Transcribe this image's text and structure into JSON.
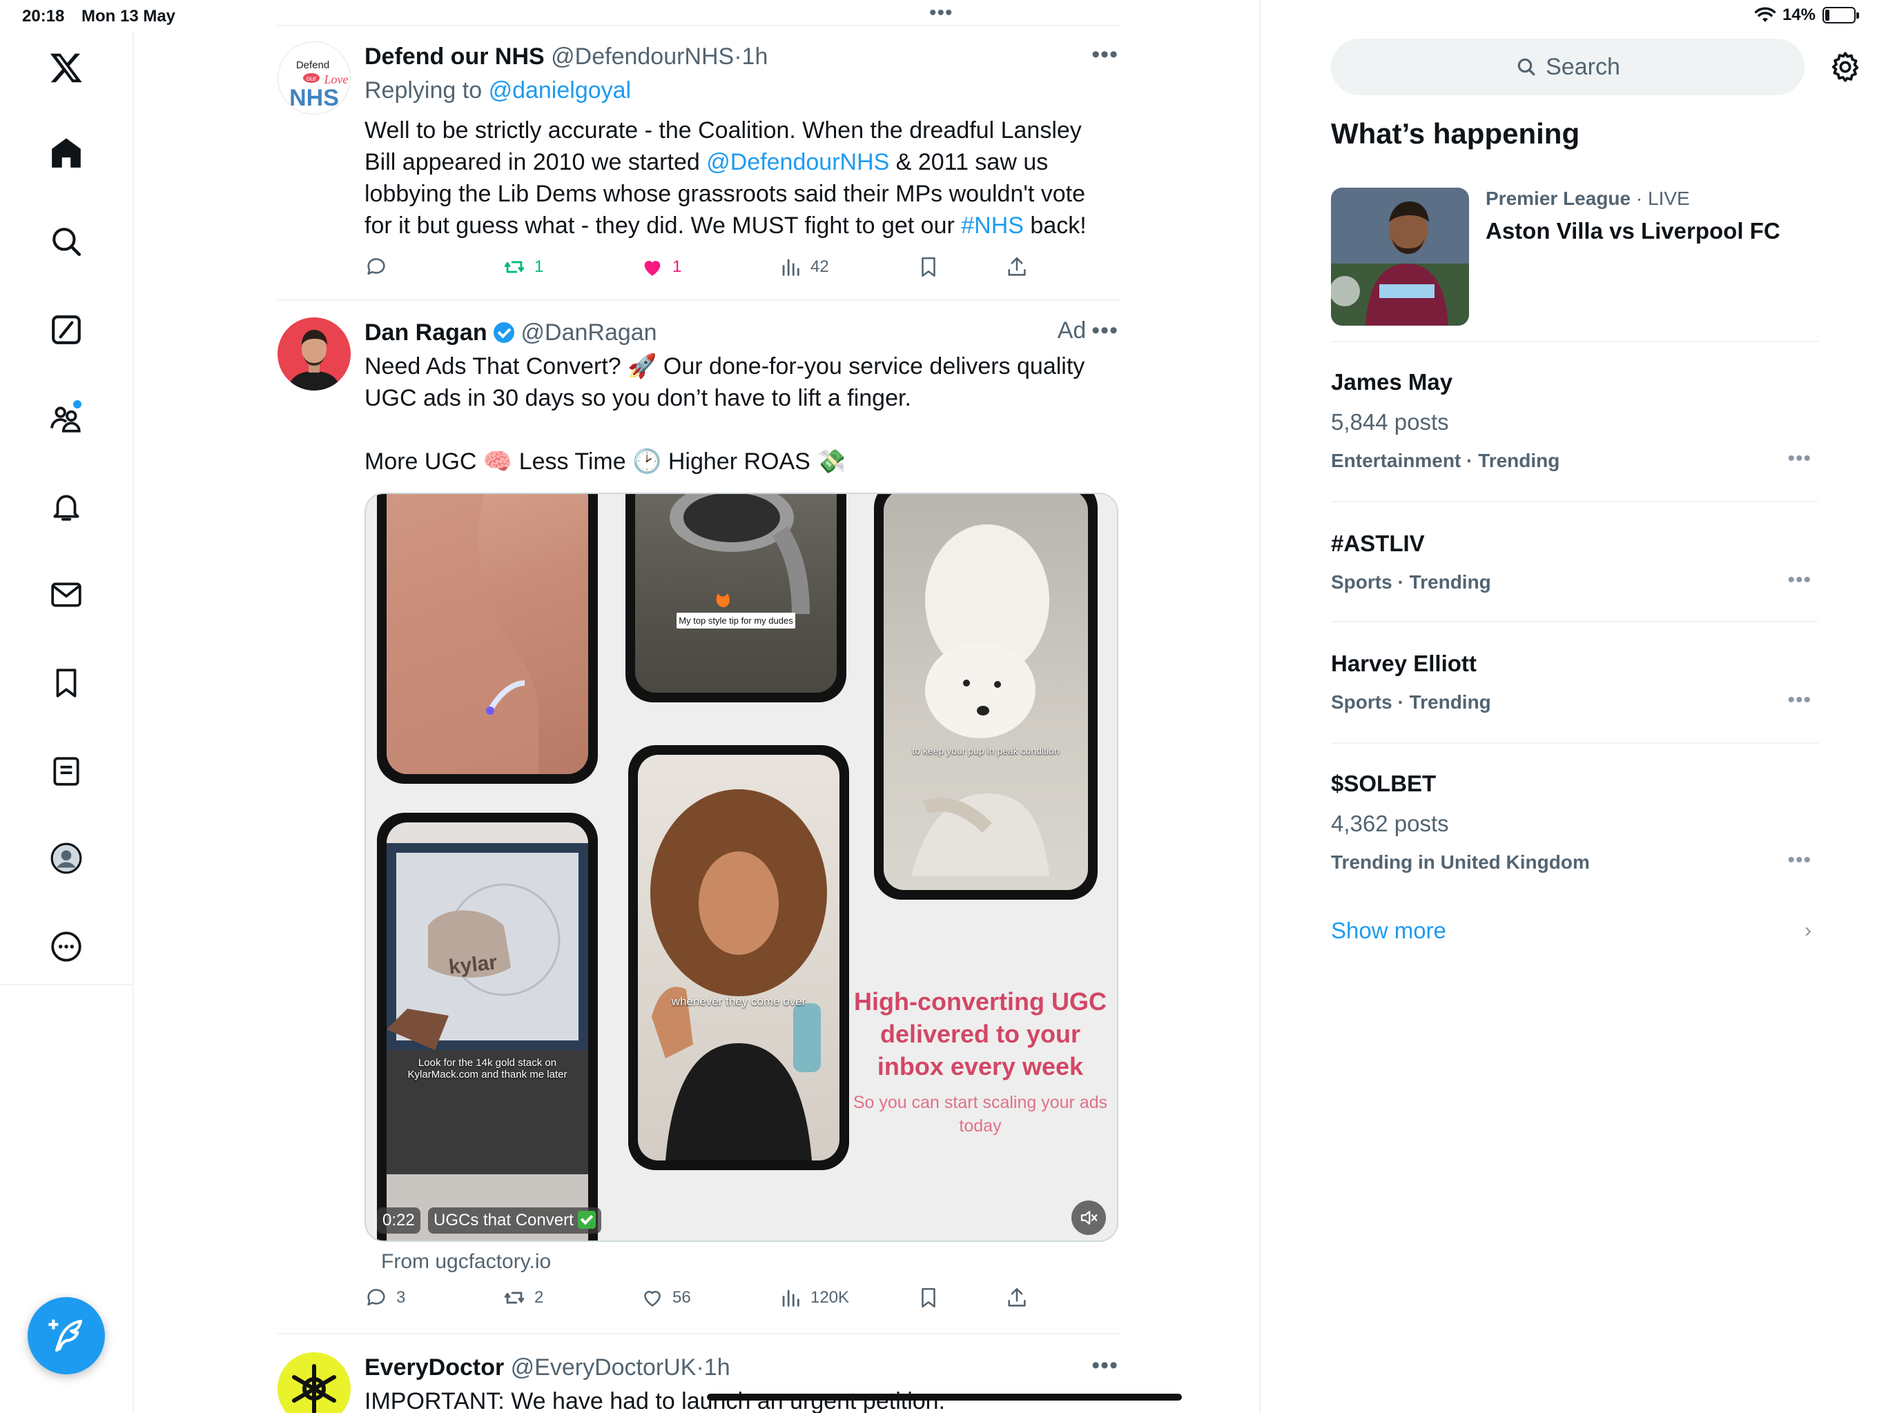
{
  "status_bar": {
    "time": "20:18",
    "date": "Mon 13 May",
    "battery": "14%",
    "battery_level": 0.14
  },
  "nav": {
    "items": [
      "x-logo",
      "home",
      "explore",
      "grok",
      "communities",
      "notifications",
      "messages",
      "bookmarks",
      "lists",
      "profile",
      "more"
    ],
    "communities_has_badge": true,
    "compose_label": "Post"
  },
  "timeline": {
    "tweets": [
      {
        "name": "Defend our NHS",
        "handle": "@DefendourNHS",
        "time": "1h",
        "avatar_text": {
          "line1": "Defend",
          "line2": "our",
          "line3": "NHS",
          "script": "Love"
        },
        "replying_prefix": "Replying to",
        "replying_to": "@danielgoyal",
        "text_a": "Well to be strictly accurate - the Coalition. When the dreadful Lansley Bill appeared in 2010 we started ",
        "mention": "@DefendourNHS",
        "text_b": "  & 2011 saw us lobbying the Lib Dems whose grassroots said their MPs wouldn't vote for it but guess what - they did. We MUST fight to get our ",
        "hashtag": "#NHS",
        "text_c": " back!",
        "reposts": "1",
        "likes": "1",
        "views": "42",
        "liked": true
      },
      {
        "name": "Dan Ragan",
        "handle": "@DanRagan",
        "ad_label": "Ad",
        "verified": true,
        "text_line1": "Need Ads That Convert? 🚀 Our done-for-you service delivers quality UGC ads in 30 days so you don’t have to lift a finger.",
        "text_line2": "More UGC 🧠 Less Time 🕑 Higher ROAS 💸",
        "media": {
          "caption_style": "My top style tip for my dudes",
          "caption_pup": "to keep your pup in peak condition",
          "caption_kylar": "Look for the 14k gold stack on KylarMack.com and thank me later",
          "kylar_bag": "kylar",
          "caption_friends": "whenever they come over",
          "promo_heading": "High-converting UGC delivered to your inbox every week",
          "promo_sub": "So you can start scaling your ads today",
          "video_time": "0:22",
          "video_label": "UGCs that Convert"
        },
        "source": "From ugcfactory.io",
        "replies": "3",
        "reposts": "2",
        "likes": "56",
        "views": "120K"
      },
      {
        "name": "EveryDoctor",
        "handle": "@EveryDoctorUK",
        "time": "1h",
        "text": "IMPORTANT: We have had to launch an urgent petition:"
      }
    ]
  },
  "sidebar": {
    "search_placeholder": "Search",
    "section_title": "What’s happening",
    "live": {
      "category": "Premier League",
      "status": "LIVE",
      "title": "Aston Villa vs Liverpool FC"
    },
    "trends": [
      {
        "name": "James May",
        "posts": "5,844 posts",
        "category": "Entertainment · Trending"
      },
      {
        "name": "#ASTLIV",
        "posts": "",
        "category": "Sports · Trending"
      },
      {
        "name": "Harvey Elliott",
        "posts": "",
        "category": "Sports · Trending"
      },
      {
        "name": "$SOLBET",
        "posts": "4,362 posts",
        "category": "Trending in United Kingdom"
      }
    ],
    "show_more": "Show more"
  },
  "colors": {
    "accent": "#1d9bf0",
    "like": "#f91880",
    "repost": "#00ba7c",
    "promo": "#d34665"
  }
}
